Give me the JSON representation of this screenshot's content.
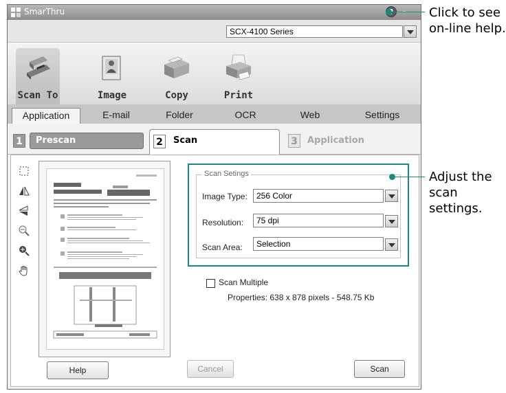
{
  "window": {
    "title": "SmarThru",
    "logo_icon": "smarthru-logo-icon",
    "help_icon": "help-icon",
    "minimize_icon": "minimize-icon"
  },
  "model_select": {
    "value": "SCX-4100 Series"
  },
  "toolbar": {
    "items": [
      {
        "label": "Scan To",
        "icon": "scanner-icon"
      },
      {
        "label": "Image",
        "icon": "image-icon"
      },
      {
        "label": "Copy",
        "icon": "copier-icon"
      },
      {
        "label": "Print",
        "icon": "printer-icon"
      }
    ]
  },
  "subtabs": [
    "Application",
    "E-mail",
    "Folder",
    "OCR",
    "Web",
    "Settings"
  ],
  "steps": [
    {
      "number": "1",
      "label": "Prescan"
    },
    {
      "number": "2",
      "label": "Scan"
    },
    {
      "number": "3",
      "label": "Application"
    }
  ],
  "side_tools": [
    "select-area-icon",
    "flip-horizontal-icon",
    "flip-vertical-icon",
    "zoom-out-icon",
    "zoom-in-icon",
    "hand-pan-icon"
  ],
  "scan_settings": {
    "legend": "Scan Setings",
    "image_type": {
      "label": "Image Type:",
      "value": "256 Color"
    },
    "resolution": {
      "label": "Resolution:",
      "value": "75 dpi"
    },
    "scan_area": {
      "label": "Scan Area:",
      "value": "Selection"
    }
  },
  "scan_multiple": {
    "label": "Scan Multiple",
    "checked": false
  },
  "properties": "Properties: 638 x 878 pixels - 548.75 Kb",
  "buttons": {
    "help": "Help",
    "cancel": "Cancel",
    "scan": "Scan"
  },
  "callouts": {
    "help": "Click to see on-line help.",
    "settings": "Adjust the scan settings."
  },
  "colors": {
    "accent": "#1a8a80",
    "title_bar": "#9a9a9a",
    "subtab_bar": "#c6c6c6"
  }
}
